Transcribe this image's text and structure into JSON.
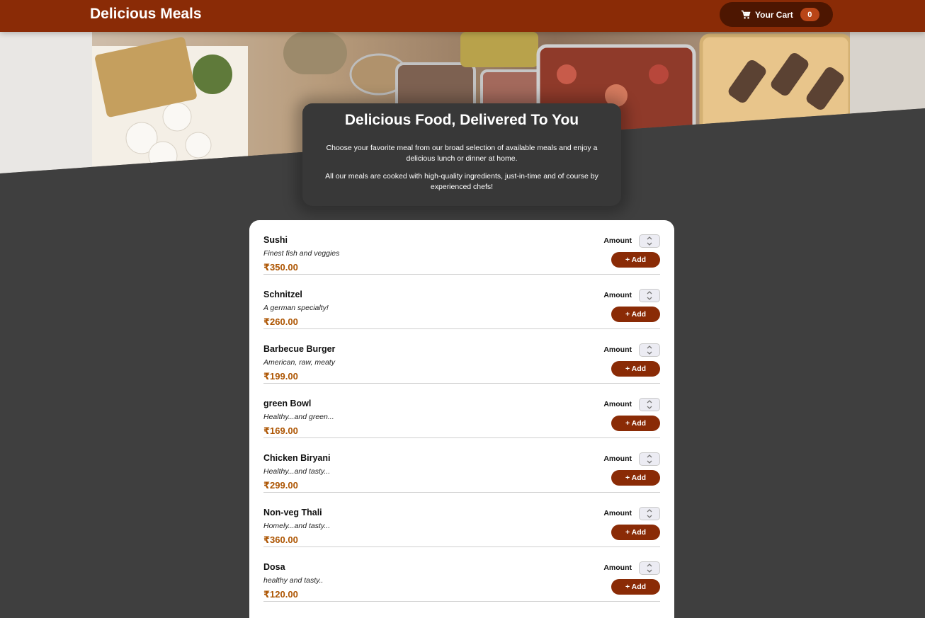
{
  "header": {
    "title": "Delicious Meals",
    "cart_label": "Your Cart",
    "cart_count": "0",
    "cart_icon": "cart-icon"
  },
  "summary": {
    "title": "Delicious Food, Delivered To You",
    "paragraph_1": "Choose your favorite meal from our broad selection of available meals and enjoy a delicious lunch or dinner at home.",
    "paragraph_2": "All our meals are cooked with high-quality ingredients, just-in-time and of course by experienced chefs!"
  },
  "meals": [
    {
      "name": "Sushi",
      "description": "Finest fish and veggies",
      "price": "₹350.00",
      "amount_label": "Amount",
      "add_label": "+ Add"
    },
    {
      "name": "Schnitzel",
      "description": "A german specialty!",
      "price": "₹260.00",
      "amount_label": "Amount",
      "add_label": "+ Add"
    },
    {
      "name": "Barbecue Burger",
      "description": "American, raw, meaty",
      "price": "₹199.00",
      "amount_label": "Amount",
      "add_label": "+ Add"
    },
    {
      "name": "green Bowl",
      "description": "Healthy...and green...",
      "price": "₹169.00",
      "amount_label": "Amount",
      "add_label": "+ Add"
    },
    {
      "name": "Chicken Biryani",
      "description": "Healthy...and tasty...",
      "price": "₹299.00",
      "amount_label": "Amount",
      "add_label": "+ Add"
    },
    {
      "name": "Non-veg Thali",
      "description": "Homely...and tasty...",
      "price": "₹360.00",
      "amount_label": "Amount",
      "add_label": "+ Add"
    },
    {
      "name": "Dosa",
      "description": "healthy and tasty..",
      "price": "₹120.00",
      "amount_label": "Amount",
      "add_label": "+ Add"
    }
  ],
  "colors": {
    "header": "#8a2b06",
    "cart_button": "#4d1601",
    "badge": "#b94517",
    "background": "#3f3f3f",
    "price": "#ad5502"
  }
}
